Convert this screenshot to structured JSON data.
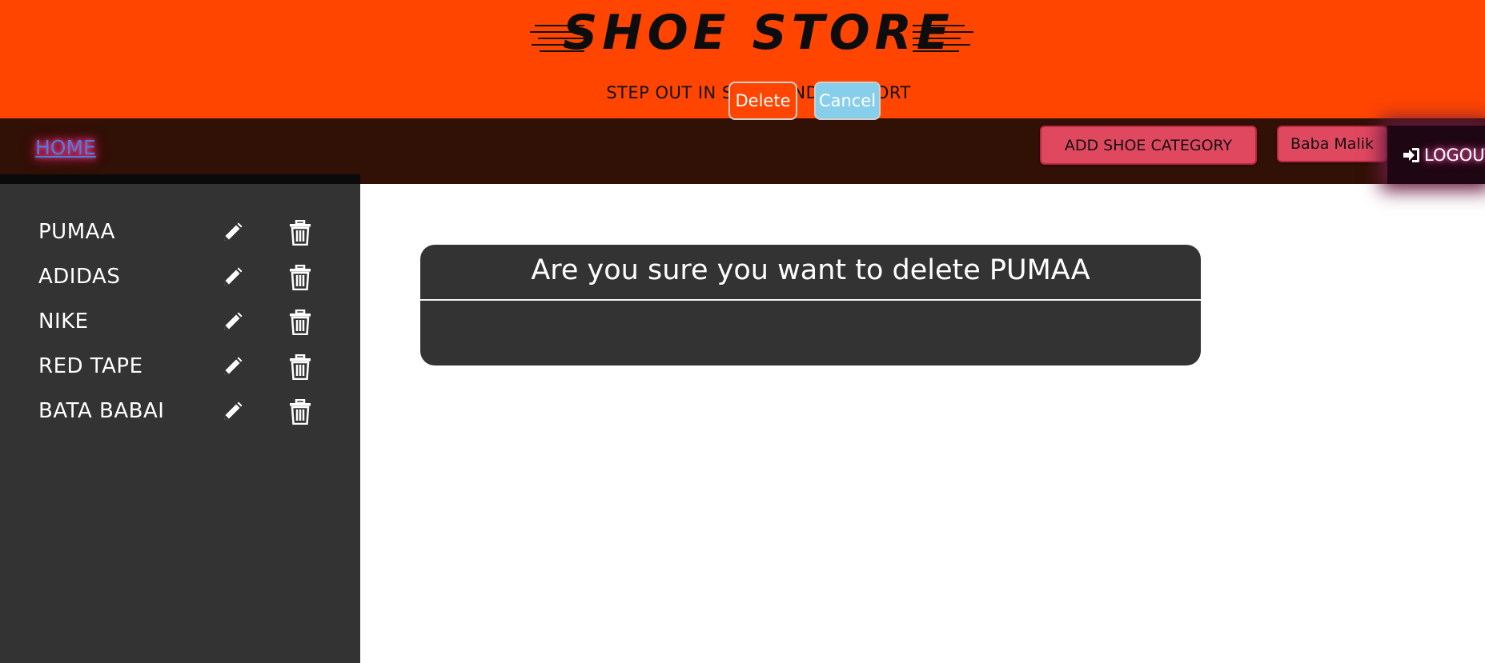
{
  "header": {
    "logo": "SHOE STORE",
    "tagline": "STEP OUT IN STYLE AND COMFORT"
  },
  "nav": {
    "home": "HOME",
    "add_category": "ADD SHOE CATEGORY",
    "user": "Baba Malik",
    "logout": "LOGOUT"
  },
  "sidebar": {
    "categories": [
      {
        "name": "PUMAA"
      },
      {
        "name": "ADIDAS"
      },
      {
        "name": "NIKE"
      },
      {
        "name": "RED TAPE"
      },
      {
        "name": "BATA BABAI"
      }
    ]
  },
  "modal": {
    "message": "Are you sure you want to delete PUMAA",
    "delete_label": "Delete",
    "cancel_label": "Cancel"
  },
  "colors": {
    "header_bg": "#ff4500",
    "nav_bg": "#311005",
    "sidebar_bg": "#333333",
    "modal_bg": "#333333",
    "pink_button": "#e04860",
    "delete_button": "#ff4500",
    "cancel_button": "#87ceeb"
  }
}
